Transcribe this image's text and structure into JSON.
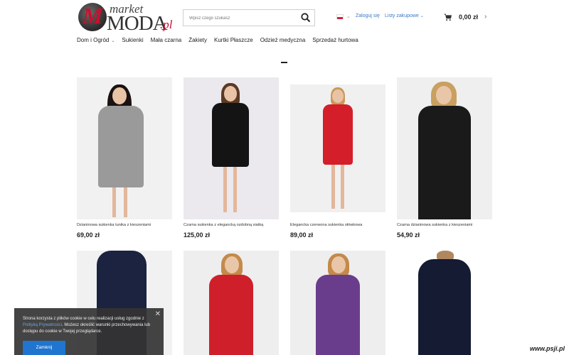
{
  "header": {
    "logo": {
      "m": "M",
      "market": "market",
      "moda": "MODA",
      "pl": ".pl"
    },
    "search": {
      "placeholder": "Wpisz czego szukasz"
    },
    "login": "Zaloguj się",
    "lists": "Listy zakupowe",
    "cart_total": "0,00 zł"
  },
  "nav": {
    "items": [
      {
        "label": "Dom i Ogród",
        "has_dropdown": true
      },
      {
        "label": "Sukienki"
      },
      {
        "label": "Mała czarna"
      },
      {
        "label": "Żakiety"
      },
      {
        "label": "Kurtki Płaszcze"
      },
      {
        "label": "Odzież medyczna"
      },
      {
        "label": "Sprzedaż hurtowa"
      }
    ]
  },
  "products": [
    {
      "name": "Dzianinowa sukienka tunika z kieszeniami",
      "price": "69,00 zł",
      "dress_color": "#9a9a9a"
    },
    {
      "name": "Czarna sukienka z elegancką ozdobną siatką",
      "price": "125,00 zł",
      "dress_color": "#141414"
    },
    {
      "name": "Elegancka czerwona sukienka ołówkowa",
      "price": "89,00 zł",
      "dress_color": "#d41e2a"
    },
    {
      "name": "Czarna dzianinowa sukienka z kieszeniami",
      "price": "54,90 zł",
      "dress_color": "#1a1a1a"
    },
    {
      "name": "",
      "price": "",
      "dress_color": "#1b2340"
    },
    {
      "name": "",
      "price": "",
      "dress_color": "#cf1f2b"
    },
    {
      "name": "",
      "price": "",
      "dress_color": "#6a3d8c"
    },
    {
      "name": "",
      "price": "",
      "dress_color": "#141b33"
    }
  ],
  "cookie": {
    "text_before": "Strona korzysta z plików cookie w celu realizacji usług zgodnie z",
    "link": "Polityką Prywatności",
    "text_after": ". Możesz określić warunki przechowywania lub dostępu do cookie w Twojej przeglądarce.",
    "button": "Zamknij"
  },
  "watermark": "www.psji.pl"
}
